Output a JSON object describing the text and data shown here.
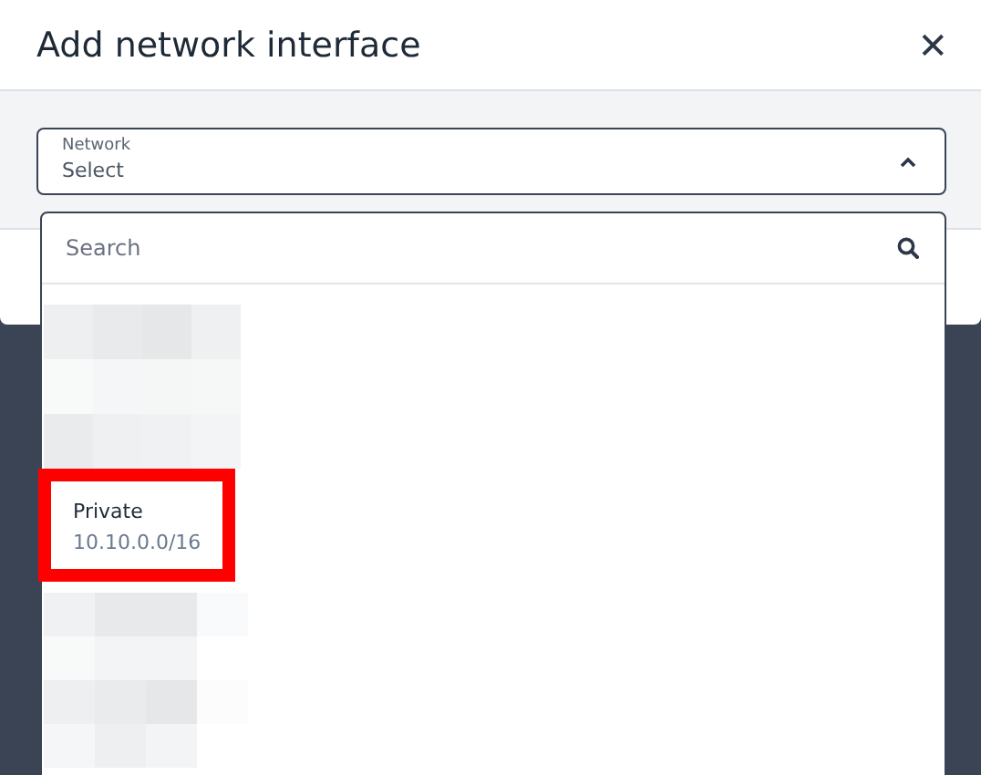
{
  "dialog": {
    "title": "Add network interface",
    "close_icon": "✕"
  },
  "network_field": {
    "label": "Network",
    "value": "Select",
    "expanded": true
  },
  "dropdown": {
    "search": {
      "placeholder": "Search"
    },
    "options": [
      {
        "kind": "redacted"
      },
      {
        "kind": "network",
        "name": "Private",
        "subnet": "10.10.0.0/16",
        "highlighted": true
      },
      {
        "kind": "redacted"
      }
    ]
  }
}
